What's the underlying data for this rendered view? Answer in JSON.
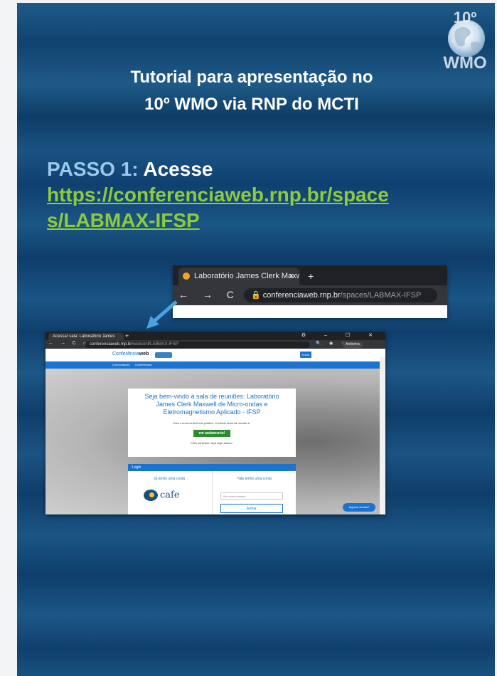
{
  "logo": {
    "text_top": "10º",
    "text_bottom": "WMO"
  },
  "title": {
    "line1": "Tutorial para apresentação no",
    "line2": "10º WMO via RNP do MCTI"
  },
  "step1": {
    "label": "PASSO 1:",
    "action": "Acesse",
    "url_line1": "https://conferenciaweb.rnp.br/space",
    "url_line2": "s/LABMAX-IFSP"
  },
  "browser_crop": {
    "tab_title": "Laboratório James Clerk Maxwell",
    "close": "×",
    "new_tab": "+",
    "nav": "← → C ⌂",
    "url_domain": "conferenciaweb.rnp.br",
    "url_path": "/spaces/LABMAX-IFSP"
  },
  "screenshot": {
    "tab_title": "Acessar sala: Laboratório James",
    "new_tab": "+",
    "window_controls": "⚙ – ☐ ✕",
    "nav": "← → C ⌂",
    "url_domain": "conferenciaweb.rnp.br",
    "url_path": "/webconf/LABMAX-IFSP",
    "toolbar_icons": "🔍 ◉ ☆",
    "user": "Anônima",
    "brand_left": "Conferência",
    "brand_right": "web",
    "header_button": "Entrar",
    "menu": "Comunidades Conferências",
    "welcome": "Seja bem-vindo à sala de reuniões: Laboratório James Clerk Maxwell de Micro-ondas e Eletromagnetismo Aplicado - IFSP",
    "conference_info": "Esta é uma conferência pública. O estado atual da reunião é:",
    "status": "em andamento!",
    "login_hint": "Para participar, faça login abaixo:",
    "login_header": "Login",
    "have_account": "Já tenho uma conta",
    "no_account": "Não tenho uma conta",
    "cafe": "cafe",
    "name_placeholder": "Seu nome completo",
    "enter": "Entrar",
    "help": "Alguma dúvida?"
  }
}
